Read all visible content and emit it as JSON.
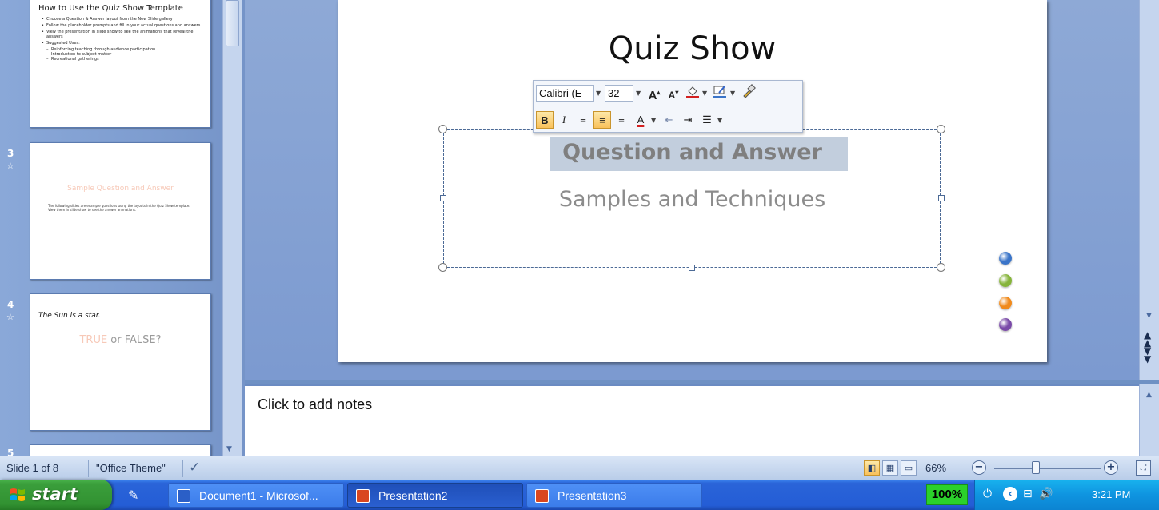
{
  "thumbnails": {
    "slide2": {
      "title": "How to Use the Quiz Show Template",
      "bullets": [
        "Choose a Question & Answer layout from the New Slide gallery",
        "Follow the placeholder prompts and fill in your actual questions and answers",
        "View the presentation in slide show to see the animations that reveal the answers",
        "Suggested Uses:"
      ],
      "sub_bullets": [
        "Reinforcing teaching through audience participation",
        "Introduction to subject matter",
        "Recreational gatherings"
      ]
    },
    "slide3": {
      "number": "3",
      "title": "Sample Question and Answer",
      "body": "The following slides are example questions using the layouts in the Quiz Show template. View them in slide show to see the answer animations."
    },
    "slide4": {
      "number": "4",
      "question": "The Sun is a star.",
      "answer_true": "TRUE",
      "answer_rest": " or FALSE?"
    },
    "slide5": {
      "number": "5"
    }
  },
  "slide": {
    "title": "Quiz Show",
    "subtitle_main": "Question and Answer",
    "subtitle_second": "Samples and Techniques",
    "dot_colors": [
      "#3a74c8",
      "#86b43a",
      "#f08a1c",
      "#7a4aa8"
    ]
  },
  "mini_toolbar": {
    "font_name": "Calibri (E",
    "font_size": "32",
    "grow_font": "A",
    "shrink_font": "A",
    "bold": "B",
    "italic": "I",
    "font_color_letter": "A"
  },
  "notes": {
    "placeholder": "Click to add notes"
  },
  "status_bar": {
    "slide_info": "Slide 1 of 8",
    "theme": "\"Office Theme\"",
    "zoom": "66%",
    "zoom_minus": "−",
    "zoom_plus": "+"
  },
  "taskbar": {
    "start_label": "start",
    "tasks": [
      {
        "label": "Document1 - Microsof...",
        "icon_color": "#2b5fc7"
      },
      {
        "label": "Presentation2",
        "icon_color": "#d9461f"
      },
      {
        "label": "Presentation3",
        "icon_color": "#d9461f"
      }
    ],
    "language": "100%",
    "clock": "3:21 PM"
  },
  "colors": {
    "accent": "#f9c15b",
    "taskbar_blue": "#245dd6",
    "start_green": "#3a9e3b",
    "tray_blue": "#0f94e0"
  }
}
